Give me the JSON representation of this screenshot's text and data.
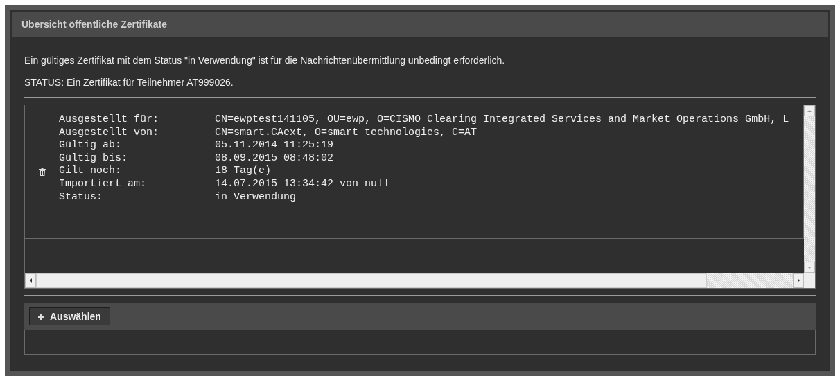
{
  "panel": {
    "title": "Übersicht öffentliche Zertifikate"
  },
  "info": "Ein gültiges Zertifikat mit dem Status \"in Verwendung\" ist für die Nachrichtenübermittlung unbedingt erforderlich.",
  "status": "STATUS: Ein Zertifikat für Teilnehmer AT999026.",
  "certificate": {
    "fields": [
      {
        "label": "Ausgestellt für:",
        "value": "CN=ewptest141105, OU=ewp, O=CISMO Clearing Integrated Services and Market Operations GmbH, L"
      },
      {
        "label": "Ausgestellt von:",
        "value": "CN=smart.CAext, O=smart technologies, C=AT"
      },
      {
        "label": "Gültig ab:",
        "value": "05.11.2014 11:25:19"
      },
      {
        "label": "Gültig bis:",
        "value": "08.09.2015 08:48:02"
      },
      {
        "label": "Gilt noch:",
        "value": "18 Tag(e)"
      },
      {
        "label": "Importiert am:",
        "value": "14.07.2015 13:34:42 von null"
      },
      {
        "label": "Status:",
        "value": "in Verwendung"
      }
    ]
  },
  "buttons": [
    {
      "label": "Auswählen"
    }
  ]
}
